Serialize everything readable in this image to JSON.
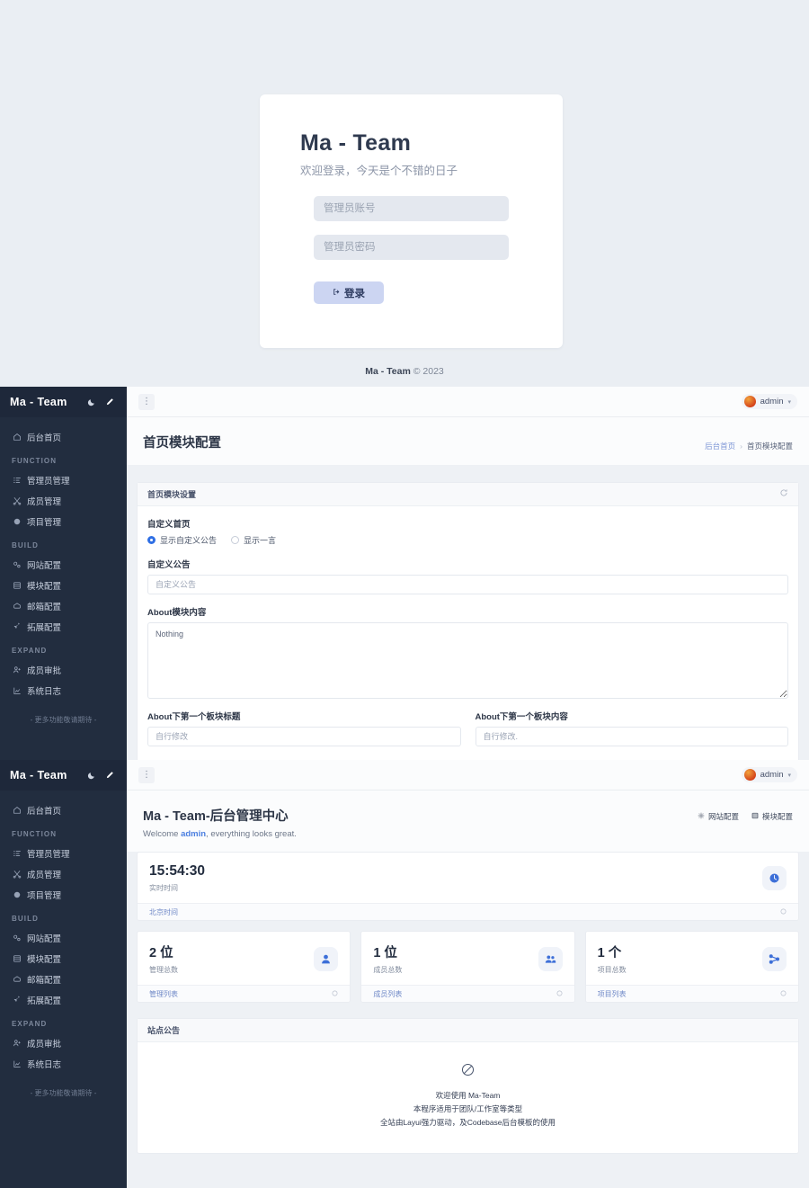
{
  "login": {
    "title": "Ma - Team",
    "subtitle": "欢迎登录，今天是个不错的日子",
    "username_placeholder": "管理员账号",
    "password_placeholder": "管理员密码",
    "button_label": "登录",
    "button_icon": "login-arrow-icon",
    "footer_brand": "Ma - Team",
    "footer_copy": "© 2023"
  },
  "sidebar": {
    "brand": "Ma - Team",
    "theme_toggle_icon": "moon-icon",
    "edit_icon": "pencil-icon",
    "home_item": {
      "label": "后台首页",
      "icon": "home-icon"
    },
    "groups": [
      {
        "title": "FUNCTION",
        "items": [
          {
            "label": "管理员管理",
            "icon": "list-icon"
          },
          {
            "label": "成员管理",
            "icon": "scissors-icon"
          },
          {
            "label": "项目管理",
            "icon": "cube-icon"
          }
        ]
      },
      {
        "title": "BUILD",
        "items": [
          {
            "label": "网站配置",
            "icon": "link-icon"
          },
          {
            "label": "模块配置",
            "icon": "grid-icon"
          },
          {
            "label": "邮箱配置",
            "icon": "envelope-icon"
          },
          {
            "label": "拓展配置",
            "icon": "rocket-icon"
          }
        ]
      },
      {
        "title": "EXPAND",
        "items": [
          {
            "label": "成员审批",
            "icon": "user-plus-icon"
          },
          {
            "label": "系统日志",
            "icon": "chart-icon"
          }
        ]
      }
    ],
    "footer_note": "- 更多功能敬请期待 -"
  },
  "topbar": {
    "menu_toggle_icon": "vertical-dots-icon",
    "username": "admin",
    "caret_icon": "chevron-down-icon",
    "avatar_icon": "user-avatar"
  },
  "module_page": {
    "title": "首页模块配置",
    "breadcrumb": {
      "root": "后台首页",
      "separator": "›",
      "current": "首页模块配置"
    },
    "card_title": "首页模块设置",
    "refresh_icon": "refresh-icon",
    "custom_home_label": "自定义首页",
    "radio_options": [
      {
        "label": "显示自定义公告",
        "selected": true
      },
      {
        "label": "显示一言",
        "selected": false
      }
    ],
    "notice_label": "自定义公告",
    "notice_placeholder": "自定义公告",
    "about_label": "About模块内容",
    "about_value": "Nothing",
    "block_title_label": "About下第一个板块标题",
    "block_title_placeholder": "自行修改",
    "block_content_label": "About下第一个板块内容",
    "block_content_placeholder": "自行修改."
  },
  "dashboard": {
    "title": "Ma - Team-后台管理中心",
    "welcome_prefix": "Welcome ",
    "welcome_user": "admin",
    "welcome_suffix": ", everything looks great.",
    "actions": [
      {
        "label": "网站配置",
        "icon": "gear-icon"
      },
      {
        "label": "模块配置",
        "icon": "grid-icon"
      }
    ],
    "clock_card": {
      "time": "15:54:30",
      "label": "实时时间",
      "footer_link": "北京时间",
      "icon": "clock-icon"
    },
    "stats": [
      {
        "value": "2 位",
        "label": "管理总数",
        "footer_link": "管理列表",
        "icon": "user-icon"
      },
      {
        "value": "1 位",
        "label": "成员总数",
        "footer_link": "成员列表",
        "icon": "users-icon"
      },
      {
        "value": "1 个",
        "label": "项目总数",
        "footer_link": "项目列表",
        "icon": "sitemap-icon"
      }
    ],
    "notice_card": {
      "title": "站点公告",
      "icon": "no-data-icon",
      "lines": [
        "欢迎使用 Ma-Team",
        "本程序适用于团队/工作室等类型",
        "全站由Layui强力驱动，及Codebase后台模板的使用"
      ]
    }
  }
}
